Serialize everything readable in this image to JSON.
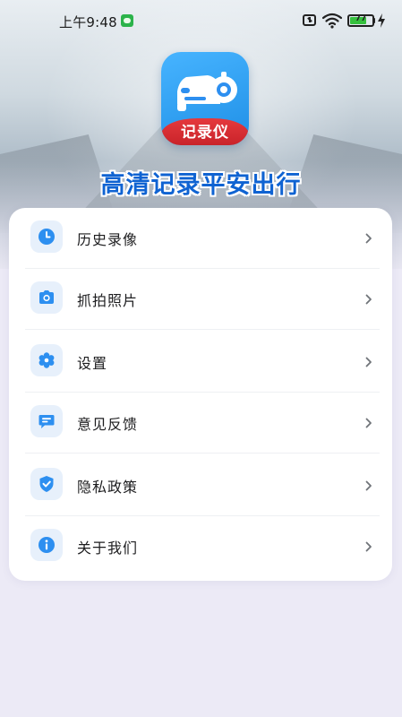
{
  "status_bar": {
    "time": "上午9:48",
    "battery": "77"
  },
  "logo": {
    "text": "记录仪"
  },
  "slogan": "高清记录平安出行",
  "menu": {
    "items": [
      {
        "label": "历史录像",
        "icon": "clock-icon"
      },
      {
        "label": "抓拍照片",
        "icon": "camera-icon"
      },
      {
        "label": "设置",
        "icon": "gear-icon"
      },
      {
        "label": "意见反馈",
        "icon": "feedback-icon"
      },
      {
        "label": "隐私政策",
        "icon": "shield-check-icon"
      },
      {
        "label": "关于我们",
        "icon": "info-icon"
      }
    ]
  },
  "colors": {
    "accent": "#2d8ff0",
    "icon_bg": "#e7f0fb",
    "slogan": "#0f63d2",
    "logo_ribbon": "#d5292f"
  }
}
